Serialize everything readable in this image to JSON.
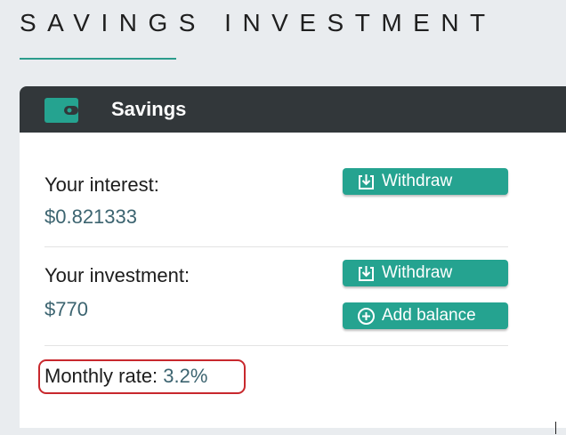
{
  "page": {
    "title": "SAVINGS INVESTMENT"
  },
  "card": {
    "title": "Savings",
    "icon": "wallet-icon"
  },
  "interest": {
    "label": "Your interest:",
    "value": "$0.821333",
    "withdraw_label": "Withdraw",
    "withdraw_icon": "download-icon"
  },
  "investment": {
    "label": "Your investment:",
    "value": "$770",
    "withdraw_label": "Withdraw",
    "withdraw_icon": "download-icon",
    "add_balance_label": "Add balance",
    "add_balance_icon": "plus-circle-icon"
  },
  "rate": {
    "label": "Monthly rate:",
    "value": "3.2%"
  },
  "colors": {
    "accent": "#25a390",
    "header_bg": "#32373a",
    "value_text": "#3c6470",
    "highlight_border": "#c8282d",
    "page_bg": "#e9ecef"
  }
}
